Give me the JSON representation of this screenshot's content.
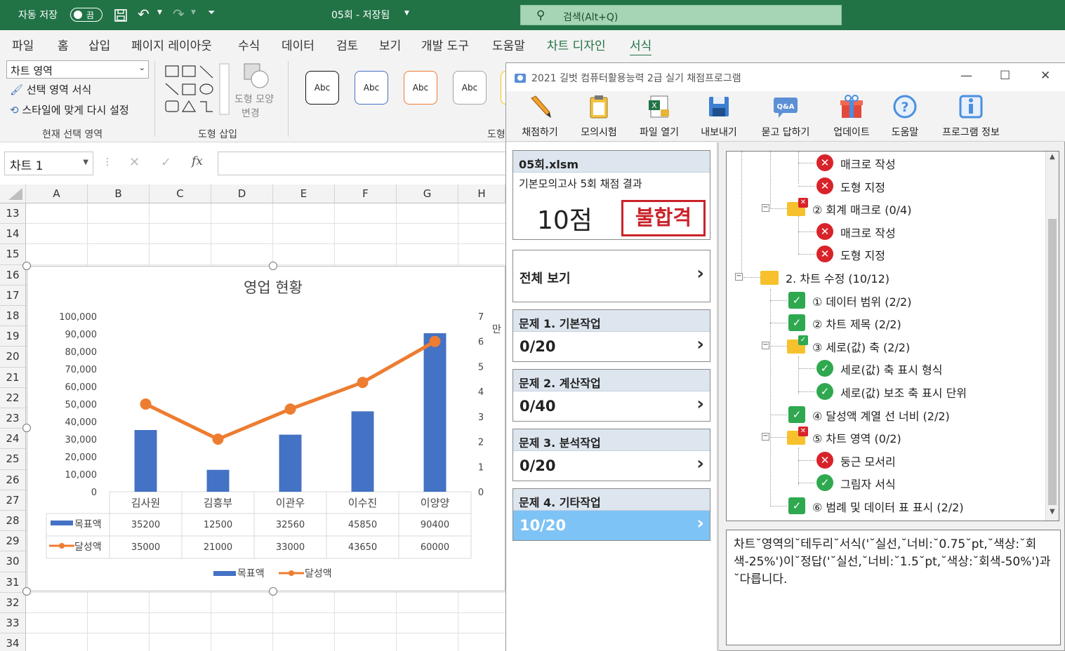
{
  "excel": {
    "autosave_label": "자동 저장",
    "autosave_state": "끔",
    "doc_title": "05회 - 저장됨",
    "search_placeholder": "검색(Alt+Q)",
    "tabs": [
      "파일",
      "홈",
      "삽입",
      "페이지 레이아웃",
      "수식",
      "데이터",
      "검토",
      "보기",
      "개발 도구",
      "도움말",
      "차트 디자인",
      "서식"
    ],
    "active_tab": "서식",
    "ribbon": {
      "chart_element_select": "차트 영역",
      "format_selection": "선택 영역 서식",
      "reset_style": "스타일에 맞게 다시 설정",
      "group_current_selection": "현재 선택 영역",
      "group_insert_shapes": "도형 삽입",
      "change_shape": "도형 모양",
      "change_shape_2": "변경",
      "shape_style_sample": "Abc",
      "group_shape_styles": "도형"
    },
    "name_box": "차트 1",
    "fx_label": "fx",
    "columns": [
      "A",
      "B",
      "C",
      "D",
      "E",
      "F",
      "G",
      "H"
    ],
    "rows": [
      "13",
      "14",
      "15",
      "16",
      "17",
      "18",
      "19",
      "20",
      "21",
      "22",
      "23",
      "24",
      "25",
      "26",
      "27",
      "28",
      "29",
      "30",
      "31",
      "32",
      "33",
      "34"
    ]
  },
  "chart_data": {
    "type": "bar",
    "title": "영업 현황",
    "categories": [
      "김사원",
      "김흥부",
      "이관우",
      "이수진",
      "이양양"
    ],
    "series": [
      {
        "name": "목표액",
        "type": "bar",
        "axis": "primary",
        "values": [
          35200,
          12500,
          32560,
          45850,
          90400
        ]
      },
      {
        "name": "달성액",
        "type": "line",
        "axis": "secondary",
        "values": [
          35000,
          21000,
          33000,
          43650,
          60000
        ]
      }
    ],
    "y_ticks": [
      "100,000",
      "90,000",
      "80,000",
      "70,000",
      "60,000",
      "50,000",
      "40,000",
      "30,000",
      "20,000",
      "10,000",
      "0"
    ],
    "ylim": [
      0,
      100000
    ],
    "y2_ticks": [
      "7",
      "6",
      "5",
      "4",
      "3",
      "2",
      "1",
      "0"
    ],
    "y2lim": [
      0,
      7
    ],
    "y2_unit": "만",
    "data_table": true,
    "legend": "bottom",
    "colors": {
      "bar": "#4472c4",
      "line": "#ed7d31"
    }
  },
  "grader": {
    "title": "2021 길벗 컴퓨터활용능력 2급 실기 채점프로그램",
    "toolbar": [
      "채점하기",
      "모의시험",
      "파일 열기",
      "내보내기",
      "묻고 답하기",
      "업데이트",
      "도움말",
      "프로그램 정보"
    ],
    "qa_badge": "Q&A",
    "result": {
      "file": "05회.xlsm",
      "subtitle": "기본모의고사 5회 채점 결과",
      "score": "10점",
      "verdict": "불합격"
    },
    "view_all": "전체 보기",
    "sections": [
      {
        "title": "문제 1. 기본작업",
        "score": "0/20"
      },
      {
        "title": "문제 2. 계산작업",
        "score": "0/40"
      },
      {
        "title": "문제 3. 분석작업",
        "score": "0/20"
      },
      {
        "title": "문제 4. 기타작업",
        "score": "10/20",
        "selected": true
      }
    ],
    "tree": [
      {
        "label": "매크로 작성",
        "status": "fail",
        "level": 3
      },
      {
        "label": "도형 지정",
        "status": "fail",
        "level": 3
      },
      {
        "label": "② 회계 매크로 (0/4)",
        "status": "folder-fail",
        "level": 2
      },
      {
        "label": "매크로 작성",
        "status": "fail",
        "level": 3
      },
      {
        "label": "도형 지정",
        "status": "fail",
        "level": 3
      },
      {
        "label": "2. 차트 수정 (10/12)",
        "status": "folder",
        "level": 1
      },
      {
        "label": "① 데이터 범위 (2/2)",
        "status": "check",
        "level": 2
      },
      {
        "label": "② 차트 제목 (2/2)",
        "status": "check",
        "level": 2
      },
      {
        "label": "③ 세로(값) 축 (2/2)",
        "status": "folder-ok",
        "level": 2
      },
      {
        "label": "세로(값) 축 표시 형식",
        "status": "ok",
        "level": 3
      },
      {
        "label": "세로(값) 보조 축 표시 단위",
        "status": "ok",
        "level": 3
      },
      {
        "label": "④ 달성액 계열 선 너비 (2/2)",
        "status": "check",
        "level": 2
      },
      {
        "label": "⑤ 차트 영역 (0/2)",
        "status": "folder-fail",
        "level": 2
      },
      {
        "label": "둥근 모서리",
        "status": "fail",
        "level": 3
      },
      {
        "label": "그림자 서식",
        "status": "ok",
        "level": 3
      },
      {
        "label": "⑥ 범례 및 데이터 표 표시 (2/2)",
        "status": "check",
        "level": 2
      }
    ],
    "message": "차트˘영역의˘테두리˘서식('˘실선,˘너비:˘0.75˘pt,˘색상:˘회색-25%')이˘정답('˘실선,˘너비:˘1.5˘pt,˘색상:˘회색-50%')과˘다릅니다."
  }
}
